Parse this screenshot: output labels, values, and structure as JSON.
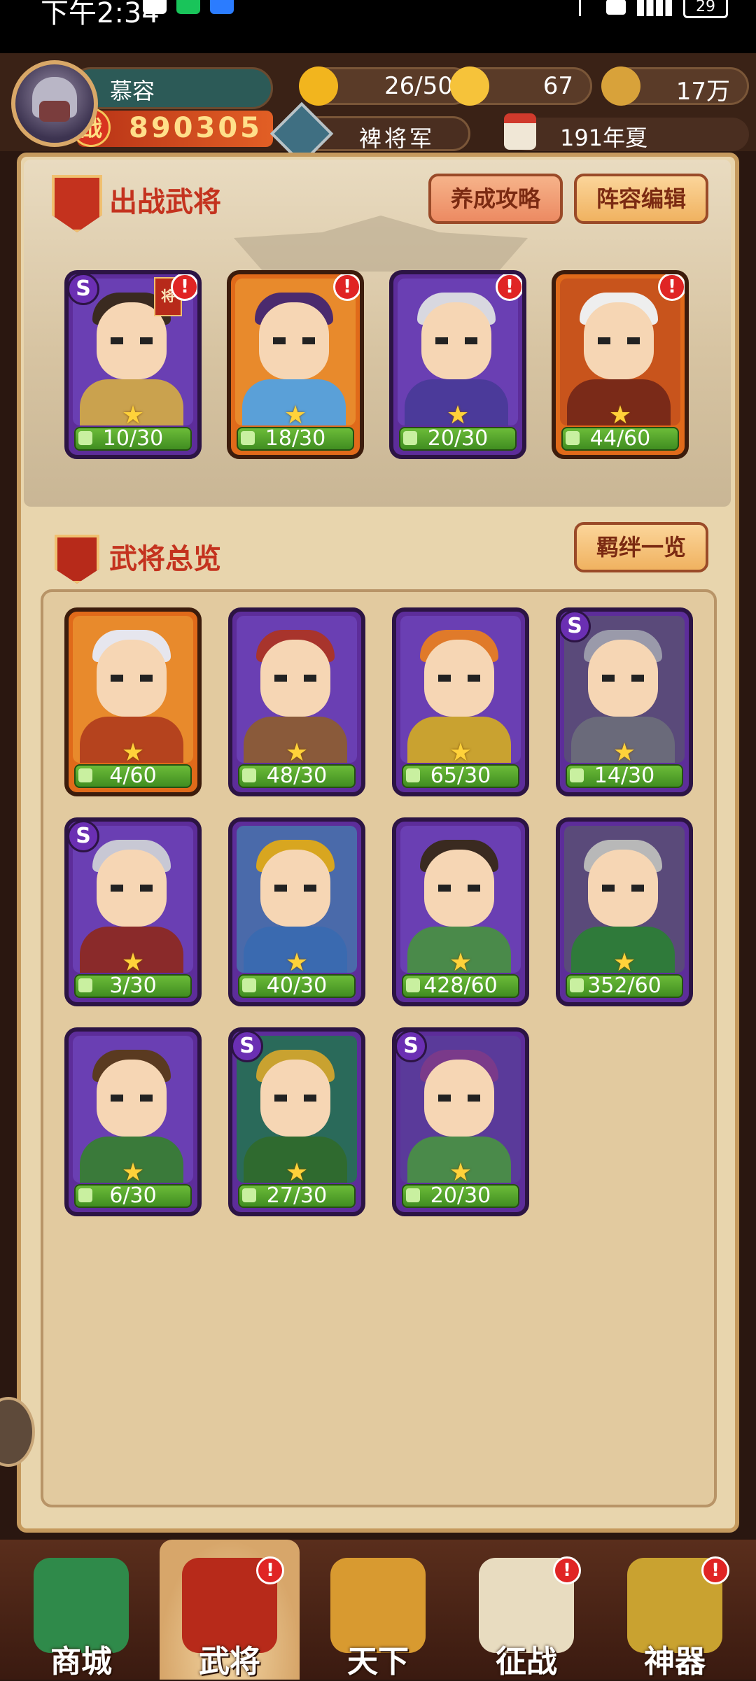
{
  "status_bar": {
    "time": "下午2:34",
    "battery": "29"
  },
  "player": {
    "name": "慕容",
    "power_badge": "战",
    "power": "890305",
    "rank": "裨将军",
    "date": "191年夏"
  },
  "resources": [
    {
      "name": "stamina",
      "value": "26/50",
      "icon": "stamina-icon",
      "color": "#f2b51e"
    },
    {
      "name": "gold_ingot",
      "value": "67",
      "icon": "gold-ingot-icon",
      "color": "#f6c33a"
    },
    {
      "name": "coins",
      "value": "17万",
      "icon": "coins-icon",
      "color": "#d8a23a"
    }
  ],
  "battle_section": {
    "title": "出战武将",
    "buttons": {
      "guide": "养成攻略",
      "lineup": "阵容编辑"
    },
    "cards": [
      {
        "progress": "10/30",
        "rarity": "S",
        "frame": "purple",
        "alert": "!",
        "flag": "将",
        "hair": "#3a2a20",
        "body": "#caa24e",
        "bg": "#6a3fb3"
      },
      {
        "progress": "18/30",
        "rarity": "",
        "frame": "orange",
        "alert": "!",
        "hair": "#4b2a6e",
        "body": "#5aa0d8",
        "bg": "#e88a2c"
      },
      {
        "progress": "20/30",
        "rarity": "",
        "frame": "purple",
        "alert": "!",
        "hair": "#d8d8e0",
        "body": "#4b3a9a",
        "bg": "#6a3fb3"
      },
      {
        "progress": "44/60",
        "rarity": "",
        "frame": "orange",
        "alert": "!",
        "hair": "#eeeeee",
        "body": "#7a2a18",
        "bg": "#c8541c"
      }
    ]
  },
  "roster_section": {
    "title": "武将总览",
    "button": "羁绊一览",
    "cards": [
      {
        "progress": "4/60",
        "rarity": "",
        "frame": "orange",
        "hair": "#e6e6ee",
        "body": "#b5431e",
        "bg": "#e88a2c"
      },
      {
        "progress": "48/30",
        "rarity": "",
        "frame": "purple",
        "hair": "#a8342c",
        "body": "#8a5a3a",
        "bg": "#6a3fb3"
      },
      {
        "progress": "65/30",
        "rarity": "",
        "frame": "purple",
        "hair": "#e07a2a",
        "body": "#c9a230",
        "bg": "#6a3fb3"
      },
      {
        "progress": "14/30",
        "rarity": "S",
        "frame": "purple",
        "hair": "#9a9aaa",
        "body": "#6a6a7a",
        "bg": "#5a4a7a"
      },
      {
        "progress": "3/30",
        "rarity": "S",
        "frame": "purple",
        "hair": "#c8c8d4",
        "body": "#8a2a2a",
        "bg": "#6a3fb3"
      },
      {
        "progress": "40/30",
        "rarity": "",
        "frame": "purple",
        "hair": "#d8a620",
        "body": "#3a6ab0",
        "bg": "#4a6aaa"
      },
      {
        "progress": "428/60",
        "rarity": "",
        "frame": "purple",
        "hair": "#3a2a20",
        "body": "#4a8a4a",
        "bg": "#6a3fb3"
      },
      {
        "progress": "352/60",
        "rarity": "",
        "frame": "purple",
        "hair": "#b8b8b8",
        "body": "#2f7a3a",
        "bg": "#5a4a7a"
      },
      {
        "progress": "6/30",
        "rarity": "",
        "frame": "purple",
        "hair": "#5a3a20",
        "body": "#3a7a3a",
        "bg": "#6a3fb3"
      },
      {
        "progress": "27/30",
        "rarity": "S",
        "frame": "purple",
        "hair": "#c9a230",
        "body": "#2f6a2f",
        "bg": "#2a6a5a"
      },
      {
        "progress": "20/30",
        "rarity": "S",
        "frame": "purple",
        "hair": "#7a3a8a",
        "body": "#4a8a4a",
        "bg": "#5a3a9a"
      }
    ]
  },
  "bottom_nav": [
    {
      "label": "商城",
      "icon": "shop-pagoda-icon",
      "color": "#2f8a4a",
      "alert": ""
    },
    {
      "label": "武将",
      "icon": "general-helmet-icon",
      "color": "#b72a1a",
      "alert": "!",
      "active": true
    },
    {
      "label": "天下",
      "icon": "crossed-swords-icon",
      "color": "#d89a30",
      "alert": ""
    },
    {
      "label": "征战",
      "icon": "battle-flag-icon",
      "color": "#e8dcc0",
      "alert": "!"
    },
    {
      "label": "神器",
      "icon": "divine-sword-icon",
      "color": "#c9a230",
      "alert": "!"
    }
  ]
}
